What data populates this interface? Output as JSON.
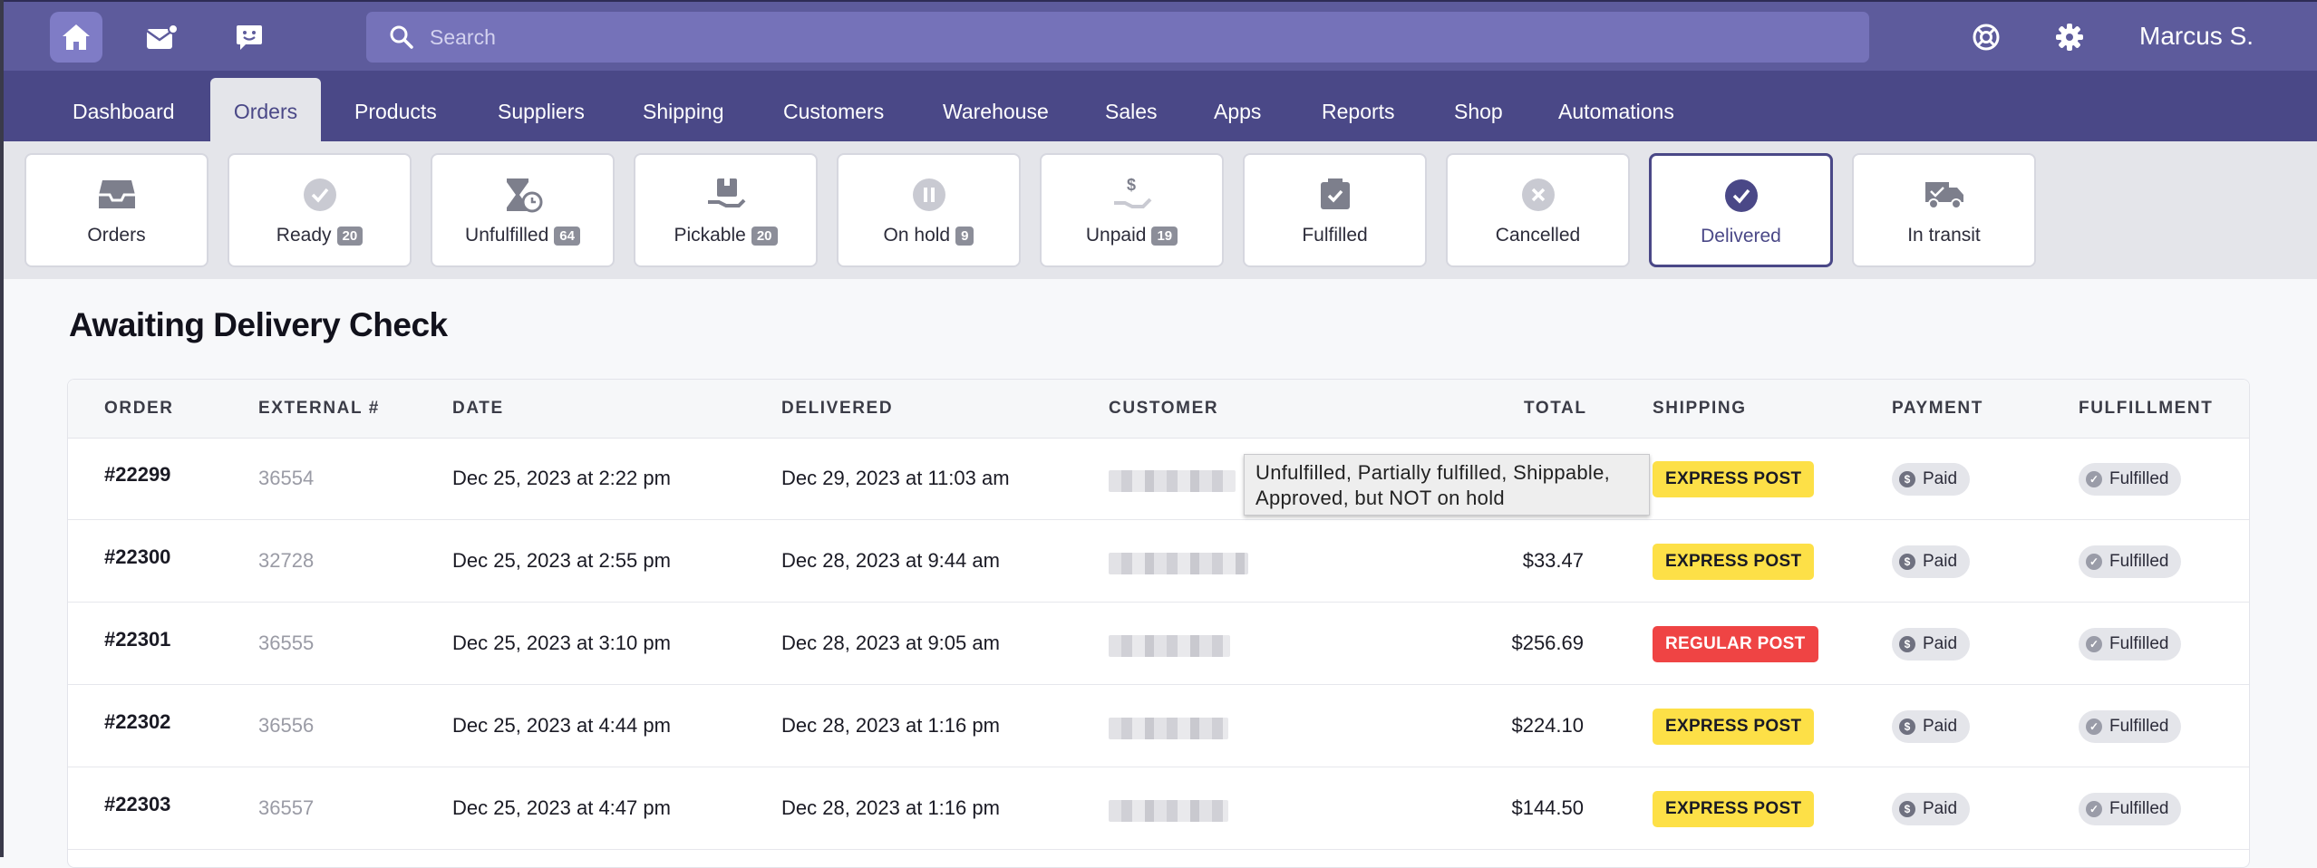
{
  "topbar": {
    "search": {
      "placeholder": "Search"
    },
    "icons": {
      "home": "home-icon",
      "mail": "mail-icon",
      "chat": "chat-icon",
      "help": "lifebuoy-icon",
      "settings": "gear-icon"
    },
    "user_name": "Marcus S."
  },
  "nav": {
    "tabs": [
      {
        "label": "Dashboard"
      },
      {
        "label": "Orders",
        "active": true
      },
      {
        "label": "Products"
      },
      {
        "label": "Suppliers"
      },
      {
        "label": "Shipping"
      },
      {
        "label": "Customers"
      },
      {
        "label": "Warehouse"
      },
      {
        "label": "Sales"
      },
      {
        "label": "Apps"
      },
      {
        "label": "Reports"
      },
      {
        "label": "Shop"
      },
      {
        "label": "Automations"
      }
    ]
  },
  "filters": [
    {
      "label": "Orders",
      "count": null,
      "icon": "inbox-icon"
    },
    {
      "label": "Ready",
      "count": "20",
      "icon": "check-circle-icon"
    },
    {
      "label": "Unfulfilled",
      "count": "64",
      "icon": "hourglass-clock-icon"
    },
    {
      "label": "Pickable",
      "count": "20",
      "icon": "box-hand-icon"
    },
    {
      "label": "On hold",
      "count": "9",
      "icon": "pause-circle-icon"
    },
    {
      "label": "Unpaid",
      "count": "19",
      "icon": "dollar-hand-icon"
    },
    {
      "label": "Fulfilled",
      "count": null,
      "icon": "box-check-icon"
    },
    {
      "label": "Cancelled",
      "count": null,
      "icon": "x-circle-icon"
    },
    {
      "label": "Delivered",
      "count": null,
      "icon": "check-circle-icon",
      "selected": true
    },
    {
      "label": "In transit",
      "count": null,
      "icon": "truck-icon"
    }
  ],
  "page": {
    "title": "Awaiting Delivery Check"
  },
  "table": {
    "headers": [
      "ORDER",
      "EXTERNAL #",
      "DATE",
      "DELIVERED",
      "CUSTOMER",
      "TOTAL",
      "SHIPPING",
      "PAYMENT",
      "FULFILLMENT"
    ],
    "rows": [
      {
        "order": "#22299",
        "external": "36554",
        "date": "Dec 25, 2023 at 2:22 pm",
        "delivered": "Dec 29, 2023 at 11:03 am",
        "total": "",
        "shipping": "EXPRESS POST",
        "shipping_type": "express",
        "payment": "Paid",
        "fulfillment": "Fulfilled"
      },
      {
        "order": "#22300",
        "external": "32728",
        "date": "Dec 25, 2023 at 2:55 pm",
        "delivered": "Dec 28, 2023 at 9:44 am",
        "total": "$33.47",
        "shipping": "EXPRESS POST",
        "shipping_type": "express",
        "payment": "Paid",
        "fulfillment": "Fulfilled"
      },
      {
        "order": "#22301",
        "external": "36555",
        "date": "Dec 25, 2023 at 3:10 pm",
        "delivered": "Dec 28, 2023 at 9:05 am",
        "total": "$256.69",
        "shipping": "REGULAR POST",
        "shipping_type": "regular",
        "payment": "Paid",
        "fulfillment": "Fulfilled"
      },
      {
        "order": "#22302",
        "external": "36556",
        "date": "Dec 25, 2023 at 4:44 pm",
        "delivered": "Dec 28, 2023 at 1:16 pm",
        "total": "$224.10",
        "shipping": "EXPRESS POST",
        "shipping_type": "express",
        "payment": "Paid",
        "fulfillment": "Fulfilled"
      },
      {
        "order": "#22303",
        "external": "36557",
        "date": "Dec 25, 2023 at 4:47 pm",
        "delivered": "Dec 28, 2023 at 1:16 pm",
        "total": "$144.50",
        "shipping": "EXPRESS POST",
        "shipping_type": "express",
        "payment": "Paid",
        "fulfillment": "Fulfilled"
      }
    ]
  },
  "tooltip": {
    "line1": "Unfulfilled, Partially fulfilled, Shippable,",
    "line2": "Approved, but NOT on hold"
  },
  "colors": {
    "topbar": "#5d5b9c",
    "nav": "#4a4887",
    "accent": "#4a4887",
    "express": "#fde047",
    "regular": "#ef4444"
  }
}
